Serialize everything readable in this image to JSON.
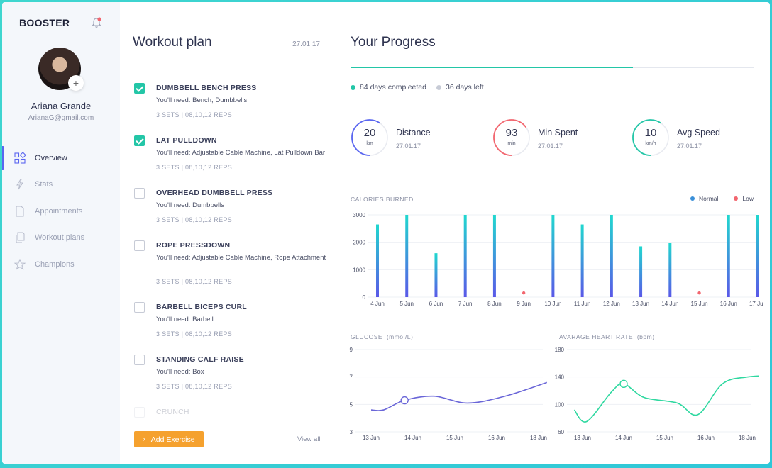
{
  "app": {
    "brand": "BOOSTER"
  },
  "user": {
    "name": "Ariana Grande",
    "email": "ArianaG@gmail.com",
    "add_label": "+"
  },
  "nav": [
    {
      "label": "Overview",
      "icon": "grid-icon",
      "active": true
    },
    {
      "label": "Stats",
      "icon": "lightning-icon",
      "active": false
    },
    {
      "label": "Appointments",
      "icon": "document-icon",
      "active": false
    },
    {
      "label": "Workout plans",
      "icon": "documents-icon",
      "active": false
    },
    {
      "label": "Champions",
      "icon": "star-icon",
      "active": false
    }
  ],
  "workout": {
    "title": "Workout plan",
    "date": "27.01.17",
    "exercises": [
      {
        "name": "DUMBBELL BENCH PRESS",
        "need": "You'll need: Bench, Dumbbells",
        "sets": "3 SETS  |  08,10,12 REPS",
        "checked": true
      },
      {
        "name": "LAT PULLDOWN",
        "need": "You'll need: Adjustable Cable Machine, Lat Pulldown Bar",
        "sets": "3 SETS  |  08,10,12 REPS",
        "checked": true
      },
      {
        "name": "OVERHEAD DUMBBELL PRESS",
        "need": "You'll need: Dumbbells",
        "sets": "3 SETS  |  08,10,12 REPS",
        "checked": false
      },
      {
        "name": "ROPE PRESSDOWN",
        "need": "You'll need: Adjustable Cable Machine, Rope Attachment",
        "sets": "3 SETS  |  08,10,12 REPS",
        "checked": false
      },
      {
        "name": "BARBELL BICEPS CURL",
        "need": "You'll need: Barbell",
        "sets": "3 SETS  |  08,10,12 REPS",
        "checked": false
      },
      {
        "name": "STANDING CALF RAISE",
        "need": "You'll need: Box",
        "sets": "3 SETS  |  08,10,12 REPS",
        "checked": false
      },
      {
        "name": "CRUNCH",
        "need": "",
        "sets": "",
        "checked": false
      }
    ],
    "add_button": "Add Exercise",
    "view_all": "View all"
  },
  "progress": {
    "title": "Your Progress",
    "completed_fraction": 0.7,
    "days_completed": "84 days compleeted",
    "days_left": "36 days left",
    "stats": [
      {
        "value": "20",
        "unit": "km",
        "label": "Distance",
        "date": "27.01.17",
        "color": "#5a66f0",
        "fraction": 0.6
      },
      {
        "value": "93",
        "unit": "min",
        "label": "Min Spent",
        "date": "27.01.17",
        "color": "#f2666f",
        "fraction": 0.65
      },
      {
        "value": "10",
        "unit": "km/h",
        "label": "Avg Speed",
        "date": "27.01.17",
        "color": "#23c6a7",
        "fraction": 0.6
      }
    ]
  },
  "colors": {
    "accent": "#23c6a7",
    "primary": "#5a66f0",
    "low": "#f2666f",
    "orange": "#f5a12e",
    "muted": "#c7cbd6"
  },
  "chart_data": [
    {
      "type": "bar",
      "title": "CALORIES BURNED",
      "categories": [
        "4 Jun",
        "5 Jun",
        "6 Jun",
        "7 Jun",
        "8 Jun",
        "9 Jun",
        "10 Jun",
        "11 Jun",
        "12 Jun",
        "13 Jun",
        "14 Jun",
        "15 Jun",
        "16 Jun",
        "17 Jun"
      ],
      "values": [
        2650,
        3000,
        1600,
        3000,
        3000,
        100,
        3000,
        2650,
        3000,
        1850,
        1980,
        100,
        3000,
        3000
      ],
      "status": [
        "Normal",
        "Normal",
        "Normal",
        "Normal",
        "Normal",
        "Low",
        "Normal",
        "Normal",
        "Normal",
        "Normal",
        "Normal",
        "Low",
        "Normal",
        "Normal"
      ],
      "legend": [
        {
          "name": "Normal",
          "color": "#3a8fd8"
        },
        {
          "name": "Low",
          "color": "#f2666f"
        }
      ],
      "yticks": [
        0,
        1000,
        2000,
        3000
      ],
      "ylim": [
        0,
        3000
      ]
    },
    {
      "type": "line",
      "title": "GLUCOSE",
      "unit": "(mmol/L)",
      "x": [
        "13 Jun",
        "14 Jun",
        "15 Jun",
        "16 Jun",
        "18 Jun"
      ],
      "points": [
        [
          0,
          4.6
        ],
        [
          0.3,
          4.6
        ],
        [
          0.8,
          5.3
        ],
        [
          1.5,
          5.6
        ],
        [
          2.3,
          5.1
        ],
        [
          3.2,
          5.6
        ],
        [
          4.2,
          6.6
        ]
      ],
      "highlight": [
        0.8,
        5.3
      ],
      "yticks": [
        3,
        5,
        7,
        9
      ],
      "ylim": [
        3,
        9
      ]
    },
    {
      "type": "line",
      "title": "AVARAGE HEART RATE",
      "unit": "(bpm)",
      "x": [
        "13 Jun",
        "14 Jun",
        "15 Jun",
        "16 Jun",
        "18 Jun"
      ],
      "points": [
        [
          -0.2,
          92
        ],
        [
          0.1,
          75
        ],
        [
          0.7,
          118
        ],
        [
          1.0,
          130
        ],
        [
          1.5,
          110
        ],
        [
          2.3,
          102
        ],
        [
          2.8,
          85
        ],
        [
          3.4,
          130
        ],
        [
          4.0,
          140
        ],
        [
          4.6,
          142
        ]
      ],
      "highlight": [
        1.0,
        130
      ],
      "yticks": [
        60,
        100,
        140,
        180
      ],
      "ylim": [
        60,
        180
      ]
    }
  ]
}
